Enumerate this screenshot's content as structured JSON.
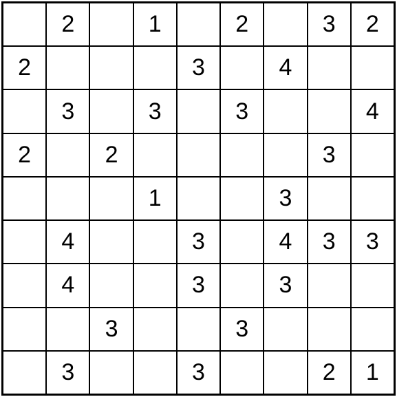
{
  "puzzle": {
    "type": "number-grid",
    "size": 9,
    "cells": [
      [
        "",
        "2",
        "",
        "1",
        "",
        "2",
        "",
        "3",
        "2"
      ],
      [
        "2",
        "",
        "",
        "",
        "3",
        "",
        "4",
        "",
        ""
      ],
      [
        "",
        "3",
        "",
        "3",
        "",
        "3",
        "",
        "",
        "4"
      ],
      [
        "2",
        "",
        "2",
        "",
        "",
        "",
        "",
        "3",
        ""
      ],
      [
        "",
        "",
        "",
        "1",
        "",
        "",
        "3",
        "",
        ""
      ],
      [
        "",
        "4",
        "",
        "",
        "3",
        "",
        "4",
        "3",
        "3"
      ],
      [
        "",
        "4",
        "",
        "",
        "3",
        "",
        "3",
        "",
        ""
      ],
      [
        "",
        "",
        "3",
        "",
        "",
        "3",
        "",
        "",
        ""
      ],
      [
        "",
        "3",
        "",
        "",
        "3",
        "",
        "",
        "2",
        "1"
      ]
    ]
  }
}
